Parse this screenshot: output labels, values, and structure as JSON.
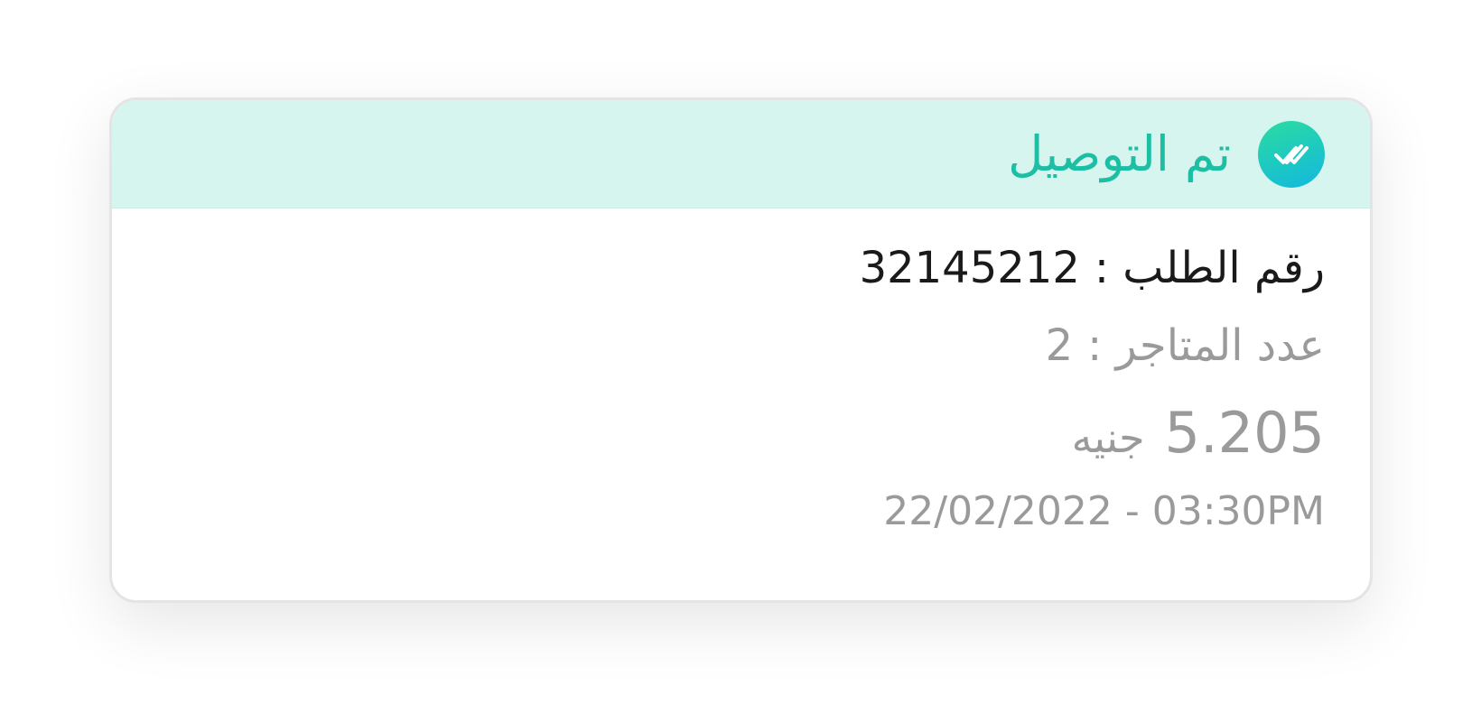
{
  "status": {
    "label": "تم التوصيل",
    "icon": "double-check-icon",
    "color": "#1dbfa4",
    "header_background": "#d6f5ef"
  },
  "order": {
    "number_label": "رقم الطلب :",
    "number_value": "32145212",
    "stores_label": "عدد المتاجر :",
    "stores_value": "2",
    "price_value": "5.205",
    "price_currency": "جنيه",
    "datetime": "22/02/2022 - 03:30PM"
  }
}
